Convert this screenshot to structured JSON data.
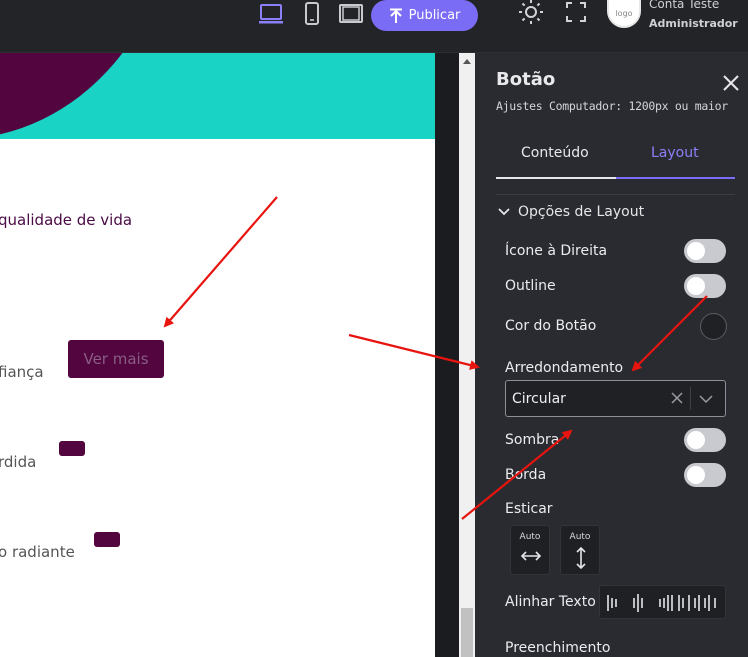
{
  "topbar": {
    "devices": [
      {
        "name": "desktop",
        "icon": "laptop-icon",
        "active": true
      },
      {
        "name": "mobile",
        "icon": "mobile-icon",
        "active": false
      },
      {
        "name": "tablet",
        "icon": "tablet-icon",
        "active": false
      }
    ],
    "publish_label": "Publicar",
    "theme_icon": "sun-icon",
    "fullscreen_icon": "fullscreen-icon",
    "account_name": "Conta Teste",
    "account_role": "Administrador",
    "avatar_text": "logo"
  },
  "preview": {
    "line1": "qualidade de vida",
    "line2": "fiança",
    "button_label": "Ver mais",
    "line3": "rdida",
    "line4": "o radiante",
    "colors": {
      "hero_bg": "#19d3c5",
      "brand": "#52053f",
      "text": "#4a0a44"
    }
  },
  "panel": {
    "title": "Botão",
    "subtitle": "Ajustes Computador: 1200px ou maior",
    "tabs": [
      {
        "label": "Conteúdo",
        "active": false
      },
      {
        "label": "Layout",
        "active": true
      }
    ],
    "section": "Opções de Layout",
    "rows": {
      "icon_right": "Ícone à Direita",
      "outline": "Outline",
      "button_color": "Cor do Botão",
      "rounding": "Arredondamento",
      "shadow": "Sombra",
      "border": "Borda",
      "stretch": "Esticar",
      "align_text": "Alinhar Texto",
      "padding": "Preenchimento"
    },
    "rounding_value": "Circular",
    "stretch_h_label": "Auto",
    "stretch_v_label": "Auto",
    "accent": "#7b6cf6"
  }
}
